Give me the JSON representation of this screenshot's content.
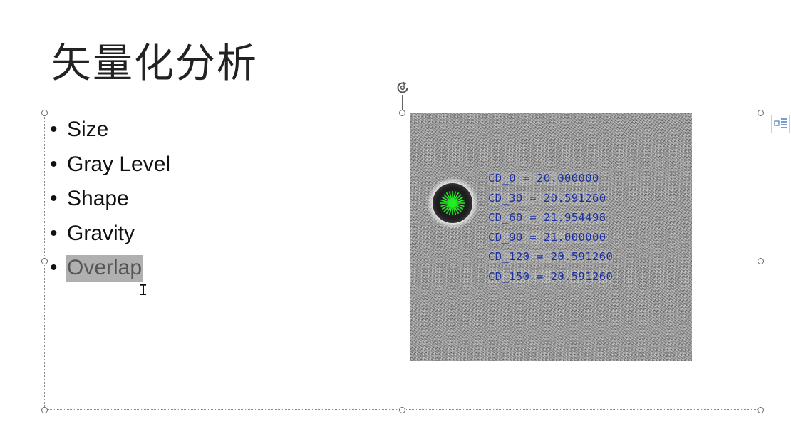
{
  "slide": {
    "title": "矢量化分析"
  },
  "bullets": [
    {
      "label": "Size",
      "selected": false
    },
    {
      "label": "Gray Level",
      "selected": false
    },
    {
      "label": "Shape",
      "selected": false
    },
    {
      "label": "Gravity",
      "selected": false
    },
    {
      "label": "Overlap",
      "selected": true
    }
  ],
  "bullet_glyph": "•",
  "image": {
    "readings": [
      "CD_0 = 20.000000",
      "CD_30 = 20.591260",
      "CD_60 = 21.954498",
      "CD_90 = 21.000000",
      "CD_120 = 20.591260",
      "CD_150 = 20.591260"
    ],
    "text_color": "#1b2fa0",
    "particle_marker_color": "#22ee22"
  },
  "cursor": {
    "glyph": "I"
  },
  "icons": {
    "rotate": "rotate-handle-icon",
    "layout_options": "layout-options-icon"
  }
}
